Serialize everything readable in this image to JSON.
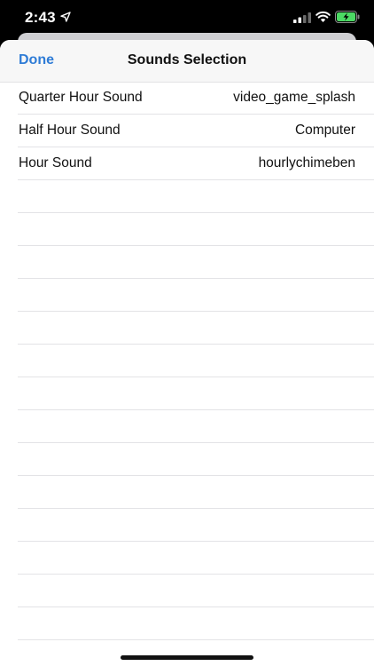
{
  "status_bar": {
    "time": "2:43",
    "battery_color": "#4cd964"
  },
  "nav": {
    "done_label": "Done",
    "title": "Sounds Selection",
    "accent_color": "#2f7cd6"
  },
  "rows": [
    {
      "label": "Quarter Hour Sound",
      "value": "video_game_splash"
    },
    {
      "label": "Half Hour Sound",
      "value": "Computer"
    },
    {
      "label": "Hour Sound",
      "value": "hourlychimeben"
    }
  ],
  "icons": [
    "location-arrow-icon",
    "cellular-signal-icon",
    "wifi-icon",
    "battery-charging-icon"
  ]
}
